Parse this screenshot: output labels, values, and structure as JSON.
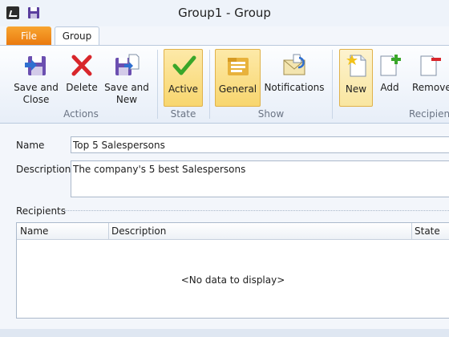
{
  "window": {
    "title": "Group1 - Group"
  },
  "tabs": {
    "file": "File",
    "group": "Group"
  },
  "ribbon": {
    "actions": {
      "label": "Actions",
      "save_close_line1": "Save and",
      "save_close_line2": "Close",
      "delete": "Delete",
      "save_new_line1": "Save and",
      "save_new_line2": "New"
    },
    "state": {
      "label": "State",
      "active": "Active"
    },
    "show": {
      "label": "Show",
      "general": "General",
      "notifications": "Notifications"
    },
    "recipients": {
      "label": "Recipient",
      "new": "New",
      "add": "Add",
      "remove": "Remove"
    }
  },
  "form": {
    "name_label": "Name",
    "name_value": "Top 5 Salespersons",
    "description_label": "Description",
    "description_value": "The company's 5 best Salespersons",
    "recipients_label": "Recipients"
  },
  "grid": {
    "columns": [
      "Name",
      "Description",
      "State"
    ],
    "empty_text": "<No data to display>"
  },
  "colors": {
    "accent_orange": "#e9780e",
    "active_yellow": "#f8d66e",
    "delete_red": "#d8262b",
    "check_green": "#3aa62a"
  }
}
